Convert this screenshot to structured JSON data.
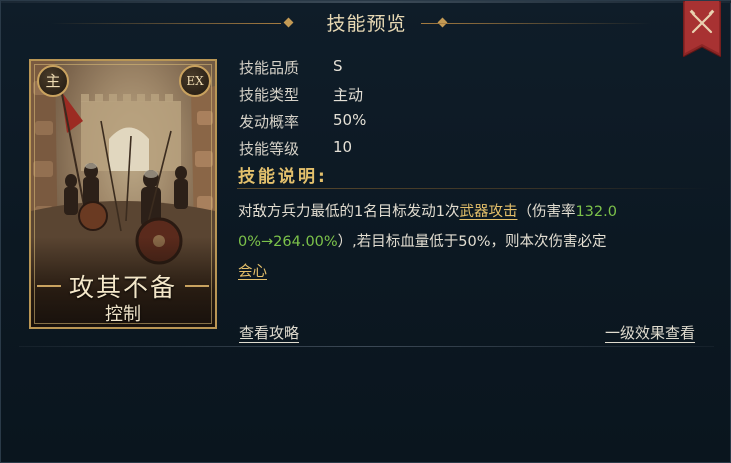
{
  "header": {
    "title": "技能预览",
    "close_icon": "crossed-swords-close-icon"
  },
  "card": {
    "badge_main": "主",
    "badge_ex": "EX",
    "name": "攻其不备",
    "type": "控制"
  },
  "info": {
    "rows": [
      {
        "label": "技能品质",
        "value": "S"
      },
      {
        "label": "技能类型",
        "value": "主动"
      },
      {
        "label": "发动概率",
        "value": "50%"
      },
      {
        "label": "技能等级",
        "value": "10"
      }
    ]
  },
  "description": {
    "title": "技能说明:",
    "part1": "对敌方兵力最低的1名目标发动1次",
    "link1": "武器攻击",
    "part2": "（伤害率",
    "green1": "132.0",
    "green2": "0%→264.00%",
    "part3": "）,若目标血量低于50%，则本次伤害必定",
    "link2": "会心"
  },
  "footer": {
    "guide_link": "查看攻略",
    "effect_link": "一级效果查看"
  },
  "colors": {
    "accent_gold": "#e3c06c",
    "link_gold": "#e4bf6a",
    "value_green": "#7cc24a",
    "close_red": "#9c2a2a"
  }
}
